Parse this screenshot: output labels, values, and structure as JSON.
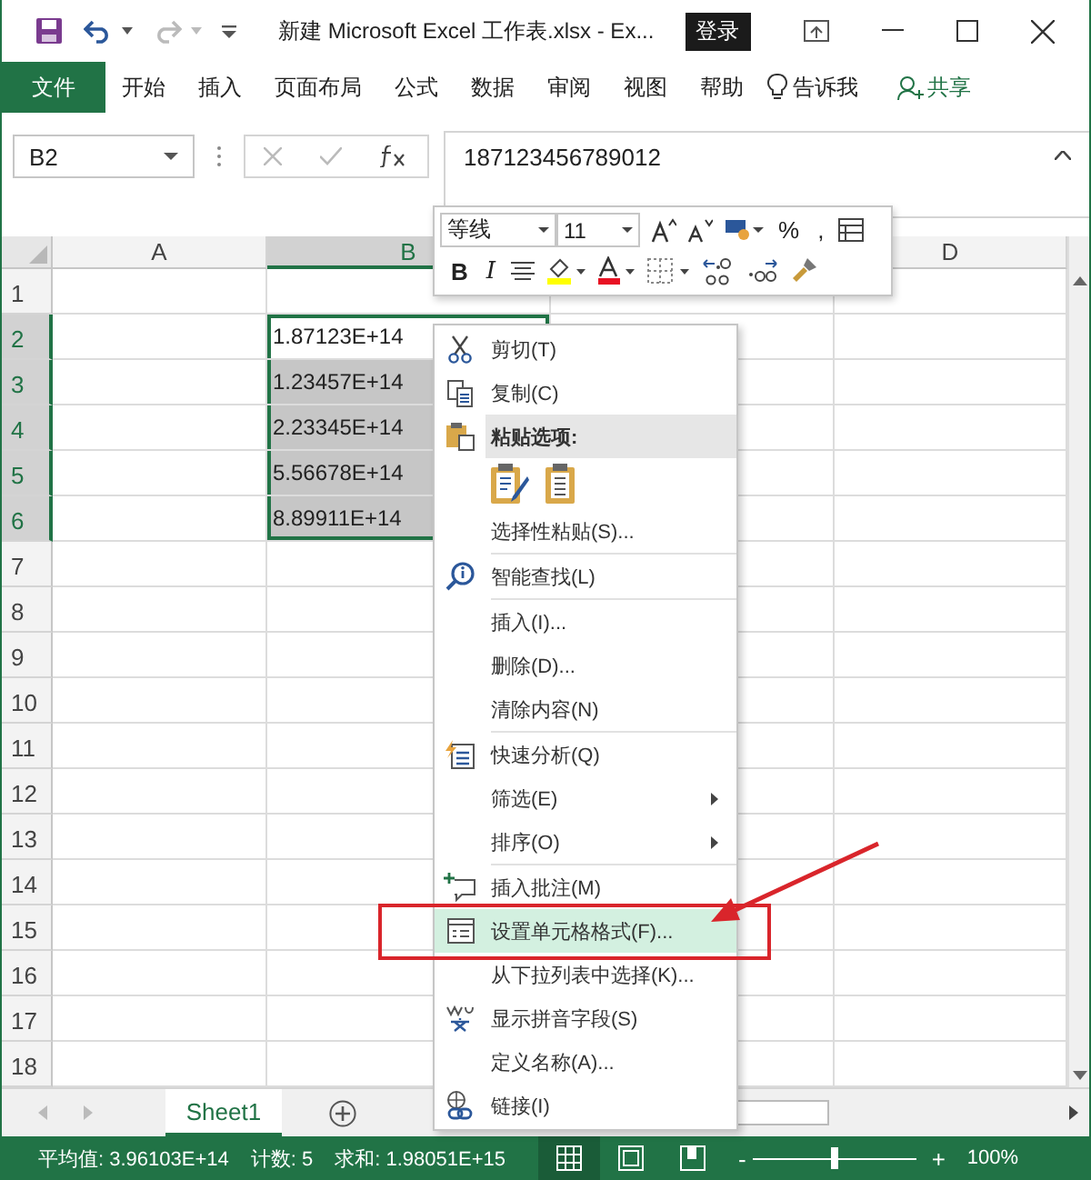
{
  "title_bar": {
    "title": "新建 Microsoft Excel 工作表.xlsx  -  Ex...",
    "sign_in": "登录"
  },
  "ribbon_tabs": [
    {
      "label": "文件",
      "kind": "file"
    },
    {
      "label": "开始",
      "kind": "tab"
    },
    {
      "label": "插入",
      "kind": "tab"
    },
    {
      "label": "页面布局",
      "kind": "tab"
    },
    {
      "label": "公式",
      "kind": "tab"
    },
    {
      "label": "数据",
      "kind": "tab"
    },
    {
      "label": "审阅",
      "kind": "tab"
    },
    {
      "label": "视图",
      "kind": "tab"
    },
    {
      "label": "帮助",
      "kind": "tab"
    },
    {
      "label": "告诉我",
      "kind": "tell"
    },
    {
      "label": "共享",
      "kind": "share"
    }
  ],
  "formula_bar": {
    "name_box": "B2",
    "value": "187123456789012"
  },
  "columns": [
    {
      "kind": "header",
      "label": "A",
      "selected": false
    },
    {
      "kind": "header",
      "label": "B",
      "selected": true
    },
    {
      "kind": "covered"
    },
    {
      "kind": "header",
      "label": "D",
      "selected": false
    }
  ],
  "rows": [
    {
      "number": "1",
      "selected": false
    },
    {
      "number": "2",
      "selected": true,
      "active": true,
      "value": "1.87123E+14"
    },
    {
      "number": "3",
      "selected": true,
      "active": false,
      "value": "1.23457E+14"
    },
    {
      "number": "4",
      "selected": true,
      "active": false,
      "value": "2.23345E+14"
    },
    {
      "number": "5",
      "selected": true,
      "active": false,
      "value": "5.56678E+14"
    },
    {
      "number": "6",
      "selected": true,
      "active": false,
      "value": "8.89911E+14"
    },
    {
      "number": "7",
      "selected": false
    },
    {
      "number": "8",
      "selected": false
    },
    {
      "number": "9",
      "selected": false
    },
    {
      "number": "10",
      "selected": false
    },
    {
      "number": "11",
      "selected": false
    },
    {
      "number": "12",
      "selected": false
    },
    {
      "number": "13",
      "selected": false
    },
    {
      "number": "14",
      "selected": false
    },
    {
      "number": "15",
      "selected": false
    },
    {
      "number": "16",
      "selected": false
    },
    {
      "number": "17",
      "selected": false
    },
    {
      "number": "18",
      "selected": false
    }
  ],
  "mini_toolbar": {
    "font": "等线",
    "size": "11",
    "bold": "B",
    "italic": "I",
    "percent": "%",
    "comma": ","
  },
  "context_menu": {
    "items": [
      {
        "kind": "item",
        "label": "剪切(T)",
        "selected": false,
        "submenu": false
      },
      {
        "kind": "item",
        "label": "复制(C)",
        "selected": false,
        "submenu": false
      },
      {
        "kind": "header",
        "label": "粘贴选项:",
        "selected": false,
        "submenu": false
      },
      {
        "kind": "paste_options"
      },
      {
        "kind": "item",
        "label": "选择性粘贴(S)...",
        "selected": false,
        "submenu": false
      },
      {
        "kind": "separator"
      },
      {
        "kind": "item",
        "label": "智能查找(L)",
        "selected": false,
        "submenu": false
      },
      {
        "kind": "separator"
      },
      {
        "kind": "item",
        "label": "插入(I)...",
        "selected": false,
        "submenu": false
      },
      {
        "kind": "item",
        "label": "删除(D)...",
        "selected": false,
        "submenu": false
      },
      {
        "kind": "item",
        "label": "清除内容(N)",
        "selected": false,
        "submenu": false
      },
      {
        "kind": "separator"
      },
      {
        "kind": "item",
        "label": "快速分析(Q)",
        "selected": false,
        "submenu": false
      },
      {
        "kind": "item",
        "label": "筛选(E)",
        "selected": false,
        "submenu": true
      },
      {
        "kind": "item",
        "label": "排序(O)",
        "selected": false,
        "submenu": true
      },
      {
        "kind": "separator"
      },
      {
        "kind": "item",
        "label": "插入批注(M)",
        "selected": false,
        "submenu": false
      },
      {
        "kind": "item",
        "label": "设置单元格格式(F)...",
        "selected": true,
        "submenu": false
      },
      {
        "kind": "item",
        "label": "从下拉列表中选择(K)...",
        "selected": false,
        "submenu": false
      },
      {
        "kind": "item",
        "label": "显示拼音字段(S)",
        "selected": false,
        "submenu": false
      },
      {
        "kind": "item",
        "label": "定义名称(A)...",
        "selected": false,
        "submenu": false
      },
      {
        "kind": "item",
        "label": "链接(I)",
        "selected": false,
        "submenu": false
      }
    ]
  },
  "sheet_tabs": [
    {
      "label": "Sheet1",
      "selected": true
    }
  ],
  "status_bar": {
    "average": "平均值: 3.96103E+14",
    "count": "计数: 5",
    "sum": "求和: 1.98051E+15",
    "views": [
      {
        "kind": "normal",
        "selected": true
      },
      {
        "kind": "page_layout",
        "selected": false
      },
      {
        "kind": "page_break",
        "selected": false
      }
    ],
    "zoom_out": "-",
    "zoom_in": "+",
    "zoom": {
      "level": 0.5
    },
    "zoom_label": "100%"
  }
}
